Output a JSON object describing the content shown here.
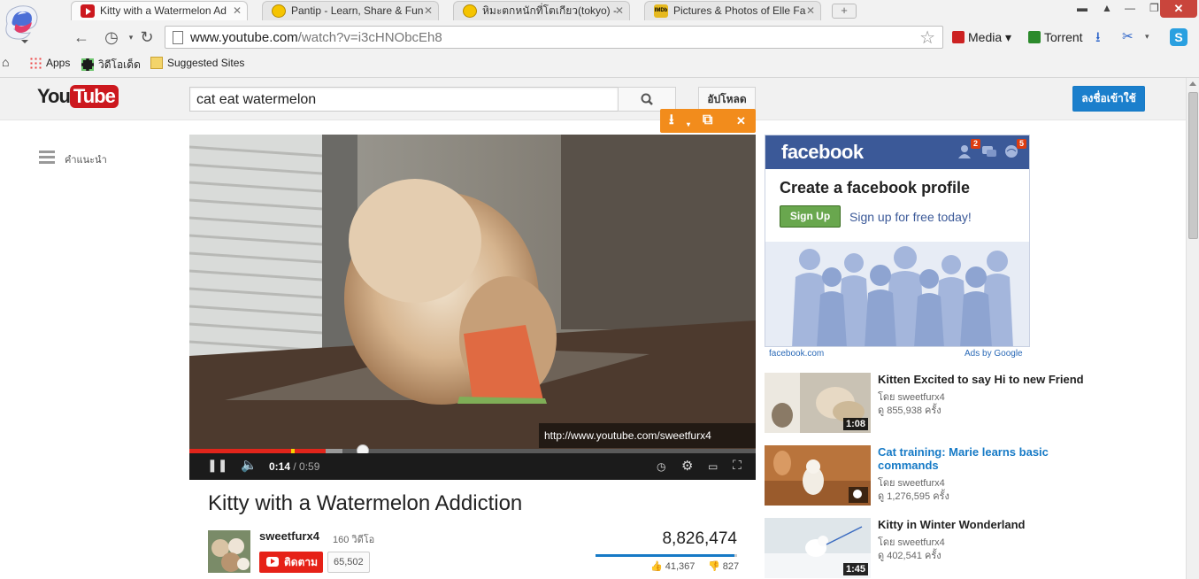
{
  "browser": {
    "tabs": [
      {
        "title": "Kitty with a Watermelon Ad",
        "favicon": "youtube-icon",
        "active": true
      },
      {
        "title": "Pantip - Learn, Share & Fun",
        "favicon": "pantip-icon",
        "active": false
      },
      {
        "title": "หิมะตกหนักที่โตเกียว(tokyo) -",
        "favicon": "pantip-icon",
        "active": false
      },
      {
        "title": "Pictures & Photos of Elle Fa",
        "favicon": "imdb-icon",
        "active": false
      }
    ],
    "tab_close_glyph": "✕",
    "new_tab_glyph": "+",
    "url_host": "www.youtube.com",
    "url_path": "/watch?v=i3cHNObcEh8",
    "extensions": [
      {
        "label": "Media ▾",
        "icon": "media-icon",
        "color": "#cc2222"
      },
      {
        "label": "Torrent",
        "icon": "torrent-icon",
        "color": "#2b8a2b"
      }
    ],
    "bookmarks": [
      {
        "label": "Apps",
        "icon": "apps-grid-icon"
      },
      {
        "label": "วิดีโอเด็ด",
        "icon": "film-icon"
      },
      {
        "label": "Suggested Sites",
        "icon": "suggested-sites-icon"
      }
    ]
  },
  "youtube": {
    "search_query": "cat eat watermelon",
    "upload_label": "อัปโหลด",
    "signin_label": "ลงชื่อเข้าใช้",
    "guide_label": "คำแนะนำ",
    "player": {
      "overlay_url": "http://www.youtube.com/sweetfurx4",
      "time_current": "0:14",
      "time_separator": " / ",
      "time_duration": "0:59",
      "played_fraction": 0.24,
      "buffered_fraction": 0.27
    },
    "video": {
      "title": "Kitty with a Watermelon Addiction",
      "channel": "sweetfurx4",
      "channel_videos": "160 วิดีโอ",
      "subscribe_label": "ติดตาม",
      "subscriber_count": "65,502",
      "views": "8,826,474",
      "likes": "41,367",
      "dislikes": "827",
      "like_ratio": 0.98
    },
    "ad": {
      "brand": "facebook",
      "notification_counts": [
        "2",
        "5"
      ],
      "headline": "Create a facebook profile",
      "button": "Sign Up",
      "tagline": "Sign up for free today!",
      "footer_left": "facebook.com",
      "footer_right": "Ads by Google"
    },
    "related": [
      {
        "title": "Kitten Excited to say Hi to new Friend",
        "by": "โดย sweetfurx4",
        "views": "ดู 855,938 ครั้ง",
        "duration": "1:08"
      },
      {
        "title": "Cat training: Marie learns basic commands",
        "by": "โดย sweetfurx4",
        "views": "ดู 1,276,595 ครั้ง",
        "duration": ""
      },
      {
        "title": "Kitty in Winter Wonderland",
        "by": "โดย sweetfurx4",
        "views": "ดู 402,541 ครั้ง",
        "duration": "1:45"
      }
    ]
  }
}
